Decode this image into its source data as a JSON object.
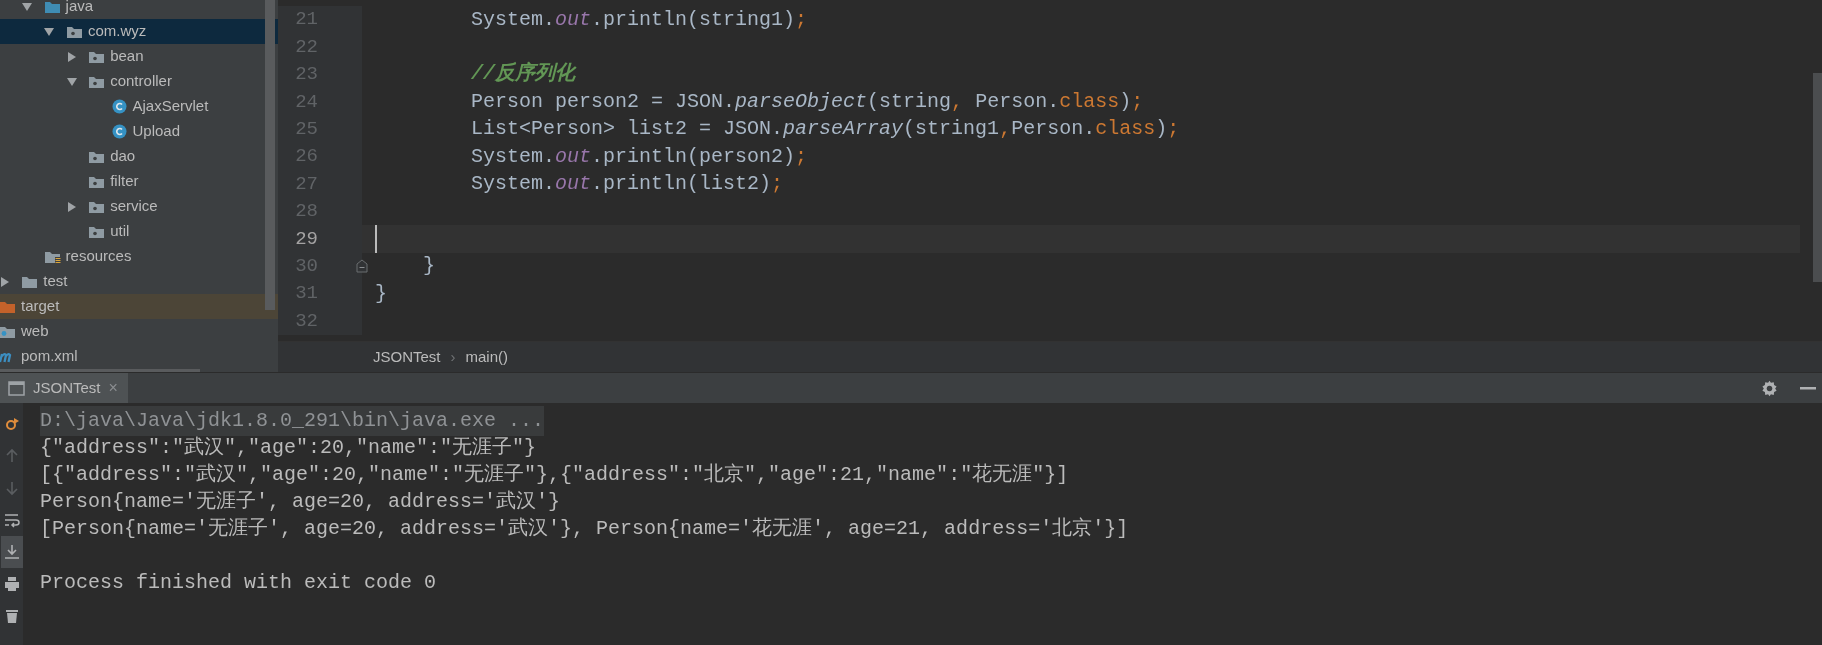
{
  "project_tree": [
    {
      "children": [
        {
          "children": [
            {
              "label": "java",
              "kind": "source-root",
              "expanded": true,
              "selected": false,
              "children": [
                {
                  "label": "com.wyz",
                  "kind": "package",
                  "expanded": true,
                  "selected": true,
                  "children": [
                    {
                      "label": "bean",
                      "kind": "package",
                      "expanded": false,
                      "selected": false
                    },
                    {
                      "label": "controller",
                      "kind": "package",
                      "expanded": true,
                      "selected": false,
                      "children": [
                        {
                          "label": "AjaxServlet",
                          "kind": "class",
                          "selected": false
                        },
                        {
                          "label": "Upload",
                          "kind": "class",
                          "selected": false
                        }
                      ]
                    },
                    {
                      "label": "dao",
                      "kind": "package",
                      "selected": false
                    },
                    {
                      "label": "filter",
                      "kind": "package",
                      "selected": false
                    },
                    {
                      "label": "service",
                      "kind": "package",
                      "expanded": false,
                      "selected": false
                    },
                    {
                      "label": "util",
                      "kind": "package",
                      "selected": false
                    }
                  ]
                }
              ]
            },
            {
              "label": "resources",
              "kind": "resources",
              "selected": false
            }
          ]
        },
        {
          "label": "test",
          "kind": "folder",
          "expanded": false,
          "selected": false
        }
      ]
    },
    {
      "label": "target",
      "kind": "excluded",
      "selected": false
    },
    {
      "label": "web",
      "kind": "web",
      "selected": false
    },
    {
      "label": "pom.xml",
      "kind": "maven",
      "selected": false
    }
  ],
  "editor": {
    "lines": [
      {
        "number": "21",
        "current": false,
        "tokens": [
          {
            "text": "        System.",
            "kind": "plain"
          },
          {
            "text": "out",
            "kind": "field"
          },
          {
            "text": ".println(string1)",
            "kind": "plain"
          },
          {
            "text": ";",
            "kind": "keyword"
          }
        ]
      },
      {
        "number": "22",
        "current": false
      },
      {
        "number": "23",
        "current": false,
        "tokens": [
          {
            "text": "        //反序列化",
            "kind": "comment"
          }
        ]
      },
      {
        "number": "24",
        "current": false,
        "tokens": [
          {
            "text": "        Person person2 = JSON.",
            "kind": "plain"
          },
          {
            "text": "parseObject",
            "kind": "method"
          },
          {
            "text": "(string",
            "kind": "plain"
          },
          {
            "text": ",",
            "kind": "keyword"
          },
          {
            "text": " Person.",
            "kind": "plain"
          },
          {
            "text": "class",
            "kind": "keyword"
          },
          {
            "text": ")",
            "kind": "plain"
          },
          {
            "text": ";",
            "kind": "keyword"
          }
        ]
      },
      {
        "number": "25",
        "current": false,
        "tokens": [
          {
            "text": "        List<Person> list2 = JSON.",
            "kind": "plain"
          },
          {
            "text": "parseArray",
            "kind": "method"
          },
          {
            "text": "(string1",
            "kind": "plain"
          },
          {
            "text": ",",
            "kind": "keyword"
          },
          {
            "text": "Person.",
            "kind": "plain"
          },
          {
            "text": "class",
            "kind": "keyword"
          },
          {
            "text": ")",
            "kind": "plain"
          },
          {
            "text": ";",
            "kind": "keyword"
          }
        ]
      },
      {
        "number": "26",
        "current": false,
        "tokens": [
          {
            "text": "        System.",
            "kind": "plain"
          },
          {
            "text": "out",
            "kind": "field"
          },
          {
            "text": ".println(person2)",
            "kind": "plain"
          },
          {
            "text": ";",
            "kind": "keyword"
          }
        ]
      },
      {
        "number": "27",
        "current": false,
        "tokens": [
          {
            "text": "        System.",
            "kind": "plain"
          },
          {
            "text": "out",
            "kind": "field"
          },
          {
            "text": ".println(list2)",
            "kind": "plain"
          },
          {
            "text": ";",
            "kind": "keyword"
          }
        ]
      },
      {
        "number": "28",
        "current": false
      },
      {
        "number": "29",
        "current": true
      },
      {
        "number": "30",
        "current": false,
        "fold": true,
        "tokens": [
          {
            "text": "    }",
            "kind": "plain"
          }
        ]
      },
      {
        "number": "31",
        "current": false,
        "tokens": [
          {
            "text": "}",
            "kind": "plain"
          }
        ]
      },
      {
        "number": "32",
        "current": false
      }
    ],
    "breadcrumb": [
      "JSONTest",
      "main()"
    ],
    "breadcrumb_separator": "›"
  },
  "run_panel": {
    "tab": {
      "label": "JSONTest",
      "close": "×",
      "selected": true
    },
    "toolbar": [
      {
        "kind": "rerun",
        "disabled": false,
        "on": false
      },
      {
        "kind": "up",
        "disabled": true,
        "on": false
      },
      {
        "kind": "down",
        "disabled": true,
        "on": false
      },
      {
        "kind": "wrap",
        "disabled": false,
        "on": false
      },
      {
        "kind": "scroll-end",
        "disabled": false,
        "on": true
      },
      {
        "kind": "print",
        "disabled": false,
        "on": false
      },
      {
        "kind": "delete",
        "disabled": false,
        "on": false
      }
    ],
    "output": [
      {
        "kind": "command",
        "text": "D:\\java\\Java\\jdk1.8.0_291\\bin\\java.exe ..."
      },
      {
        "kind": "output",
        "text": "{\"address\":\"武汉\",\"age\":20,\"name\":\"无涯子\"}"
      },
      {
        "kind": "output",
        "text": "[{\"address\":\"武汉\",\"age\":20,\"name\":\"无涯子\"},{\"address\":\"北京\",\"age\":21,\"name\":\"花无涯\"}]"
      },
      {
        "kind": "output",
        "text": "Person{name='无涯子', age=20, address='武汉'}"
      },
      {
        "kind": "output",
        "text": "[Person{name='无涯子', age=20, address='武汉'}, Person{name='花无涯', age=21, address='北京'}]"
      },
      {
        "kind": "blank"
      },
      {
        "kind": "output",
        "text": "Process finished with exit code 0"
      }
    ]
  }
}
